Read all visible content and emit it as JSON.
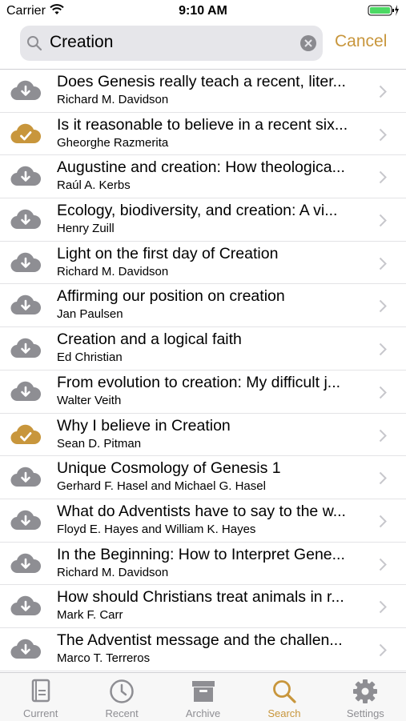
{
  "status_bar": {
    "carrier": "Carrier",
    "time": "9:10 AM"
  },
  "search": {
    "query": "Creation",
    "cancel_label": "Cancel"
  },
  "colors": {
    "accent": "#c8963c",
    "downloaded": "#c8963c",
    "not_downloaded": "#8e8e93"
  },
  "results": [
    {
      "title": "Does Genesis really teach a recent, liter...",
      "author": "Richard M. Davidson",
      "downloaded": false
    },
    {
      "title": "Is it reasonable to believe in a recent six...",
      "author": "Gheorghe Razmerita",
      "downloaded": true
    },
    {
      "title": "Augustine and creation: How theologica...",
      "author": "Raúl A. Kerbs",
      "downloaded": false
    },
    {
      "title": "Ecology, biodiversity, and creation: A vi...",
      "author": "Henry Zuill",
      "downloaded": false
    },
    {
      "title": "Light on the first day of Creation",
      "author": "Richard M. Davidson",
      "downloaded": false
    },
    {
      "title": "Affirming our position on creation",
      "author": "Jan Paulsen",
      "downloaded": false
    },
    {
      "title": "Creation and a logical faith",
      "author": "Ed Christian",
      "downloaded": false
    },
    {
      "title": "From evolution to creation: My difficult j...",
      "author": "Walter Veith",
      "downloaded": false
    },
    {
      "title": "Why I believe in Creation",
      "author": "Sean D. Pitman",
      "downloaded": true
    },
    {
      "title": "Unique Cosmology of Genesis 1",
      "author": "Gerhard F. Hasel and Michael G. Hasel",
      "downloaded": false
    },
    {
      "title": "What do Adventists have to say to the w...",
      "author": "Floyd E. Hayes and William K. Hayes",
      "downloaded": false
    },
    {
      "title": "In the Beginning: How to Interpret Gene...",
      "author": "Richard M. Davidson",
      "downloaded": false
    },
    {
      "title": "How should Christians treat animals in r...",
      "author": "Mark F. Carr",
      "downloaded": false
    },
    {
      "title": "The Adventist message and the challen...",
      "author": "Marco T. Terreros",
      "downloaded": false
    }
  ],
  "tabs": [
    {
      "label": "Current",
      "icon": "book-icon",
      "active": false
    },
    {
      "label": "Recent",
      "icon": "clock-icon",
      "active": false
    },
    {
      "label": "Archive",
      "icon": "archive-box-icon",
      "active": false
    },
    {
      "label": "Search",
      "icon": "search-icon",
      "active": true
    },
    {
      "label": "Settings",
      "icon": "gear-icon",
      "active": false
    }
  ]
}
